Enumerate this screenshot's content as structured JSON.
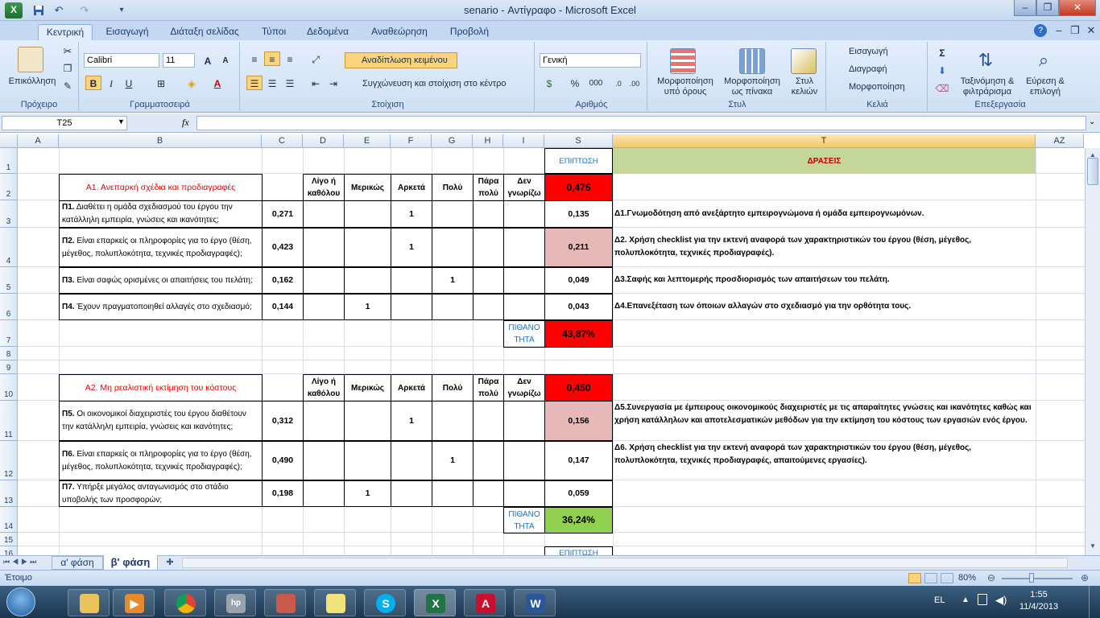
{
  "window": {
    "title": "senario - Αντίγραφο - Microsoft Excel",
    "minimize": "–",
    "restore": "❐",
    "close": "✕"
  },
  "tabs": [
    "Κεντρική",
    "Εισαγωγή",
    "Διάταξη σελίδας",
    "Τύποι",
    "Δεδομένα",
    "Αναθεώρηση",
    "Προβολή"
  ],
  "ribbon": {
    "clipboard": {
      "paste": "Επικόλληση",
      "label": "Πρόχειρο"
    },
    "font": {
      "name": "Calibri",
      "size": "11",
      "label": "Γραμματοσειρά",
      "bold": "B",
      "italic": "I",
      "underline": "U"
    },
    "alignment": {
      "wrap": "Αναδίπλωση κειμένου",
      "merge": "Συγχώνευση και στοίχιση στο κέντρο",
      "label": "Στοίχιση"
    },
    "number": {
      "format": "Γενική",
      "percent": "%",
      "thousands": "000",
      "label": "Αριθμός"
    },
    "styles": {
      "conditional": "Μορφοποίηση υπό όρους",
      "table": "Μορφοποίηση ως πίνακα",
      "cell": "Στυλ κελιών",
      "label": "Στυλ"
    },
    "cells": {
      "insert": "Εισαγωγή",
      "delete": "Διαγραφή",
      "format": "Μορφοποίηση",
      "label": "Κελιά"
    },
    "editing": {
      "sort": "Ταξινόμηση & φιλτράρισμα",
      "find": "Εύρεση & επιλογή",
      "label": "Επεξεργασία"
    }
  },
  "formula_bar": {
    "name_box": "T25",
    "fx": "fx",
    "value": ""
  },
  "columns": [
    "A",
    "B",
    "C",
    "D",
    "E",
    "F",
    "G",
    "H",
    "I",
    "S",
    "T",
    "AZ"
  ],
  "rows": [
    "1",
    "2",
    "3",
    "4",
    "5",
    "6",
    "7",
    "8",
    "9",
    "10",
    "11",
    "12",
    "13",
    "14",
    "15",
    "16"
  ],
  "sheet": {
    "S1": "ΕΠΙΠΤΩΣΗ",
    "T1": "ΔΡΑΣΕΙΣ",
    "hdr": {
      "d": "Λίγο ή καθόλου",
      "e": "Μερικώς",
      "f": "Αρκετά",
      "g": "Πολύ",
      "h": "Πάρα πολύ",
      "i": "Δεν γνωρίζω"
    },
    "sectionA1": {
      "title": "Α1. Ανεπαρκή σχέδια και προδιαγραφές",
      "impact": "0,475",
      "probability_label": "ΠΙΘΑΝΟ ΤΗΤΑ",
      "probability": "43,87%"
    },
    "rowsA1": [
      {
        "id": "Π1.",
        "text": " Διαθέτει η ομάδα σχεδιασμού του έργου την κατάλληλη εμπειρία, γνώσεις και ικανότητες;",
        "c": "0,271",
        "mark": "1",
        "s": "0,135",
        "action": "Δ1.Γνωμοδότηση από ανεξάρτητο  εμπειρογνώμονα ή ομάδα εμπειρογνωμόνων."
      },
      {
        "id": "Π2.",
        "text": " Είναι επαρκείς οι πληροφορίες για το έργο (θέση, μέγεθος, πολυπλοκότητα, τεχνικές προδιαγραφές);",
        "c": "0,423",
        "mark": "1",
        "s": "0,211",
        "action": "Δ2. Χρήση checklist για την εκτενή αναφορά των χαρακτηριστικών του έργου (θέση, μέγεθος, πολυπλοκότητα, τεχνικές προδιαγραφές)."
      },
      {
        "id": "Π3.",
        "text": " Είναι σαφώς ορισμένες οι απαιτήσεις του πελάτη;",
        "c": "0,162",
        "mark": "1",
        "s": "0,049",
        "action": "Δ3.Σαφής και λεπτομερής προσδιορισμός των απαιτήσεων του πελάτη."
      },
      {
        "id": "Π4.",
        "text": " Έχουν πραγματοποιηθεί αλλαγές στο σχεδιασμό;",
        "c": "0,144",
        "mark": "1",
        "s": "0,043",
        "action": "Δ4.Επανεξέταση των όποιων αλλαγών στο σχεδιασμό για την ορθότητα τους."
      }
    ],
    "sectionA2": {
      "title": "Α2. Μη ρεαλιστική εκτίμηση του κόστους",
      "impact": "0,450",
      "probability_label": "ΠΙΘΑΝΟ ΤΗΤΑ",
      "probability": "36,24%"
    },
    "rowsA2": [
      {
        "id": "Π5.",
        "text": " Οι οικονομικοί διαχειριστές του έργου διαθέτουν την κατάλληλη εμπειρία, γνώσεις και ικανότητες;",
        "c": "0,312",
        "mark": "1",
        "s": "0,156",
        "action": "Δ5.Συνεργασία με έμπειρους οικονομικούς διαχειριστές με τις απαραίτητες γνώσεις και ικανότητες καθώς και χρήση κατάλληλων και αποτελεσματικών μεθόδων για την εκτίμηση του κόστους των εργασιών ενός έργου."
      },
      {
        "id": "Π6.",
        "text": " Είναι επαρκείς οι πληροφορίες για το έργο (θέση, μέγεθος, πολυπλοκότητα, τεχνικές προδιαγραφές);",
        "c": "0,490",
        "mark": "1",
        "s": "0,147",
        "action": "Δ6. Χρήση checklist για την εκτενή αναφορά των χαρακτηριστικών του έργου (θέση, μέγεθος, πολυπλοκότητα, τεχνικές προδιαγραφές, απαιτούμενες εργασίες)."
      },
      {
        "id": "Π7.",
        "text": " Υπήρξε μεγάλος ανταγωνισμός στο στάδιο υποβολής των προσφορών;",
        "c": "0,198",
        "mark": "1",
        "s": "0,059",
        "action": ""
      }
    ],
    "S16": "ΕΠΙΠΤΩΣΗ"
  },
  "sheet_tabs": [
    "α' φάση",
    "β' φάση"
  ],
  "status": {
    "ready": "Έτοιμο",
    "zoom": "80%"
  },
  "taskbar": {
    "lang": "EL",
    "time": "1:55",
    "date": "11/4/2013"
  }
}
